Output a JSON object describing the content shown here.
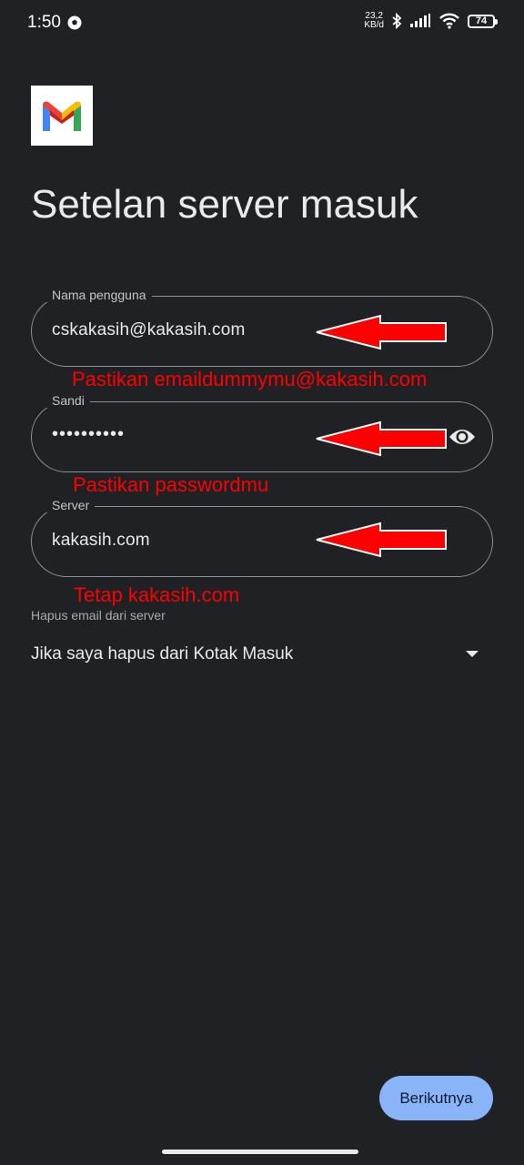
{
  "status_bar": {
    "time": "1:50",
    "net_speed_value": "23,2",
    "net_speed_unit": "KB/d",
    "battery": "74",
    "icons": [
      "soccer-ball-icon",
      "bluetooth-icon",
      "signal-icon",
      "wifi-icon",
      "battery-icon"
    ]
  },
  "page": {
    "title": "Setelan server masuk"
  },
  "fields": {
    "username": {
      "label": "Nama pengguna",
      "value": "cskakasih@kakasih.com"
    },
    "password": {
      "label": "Sandi",
      "value": "••••••••••"
    },
    "server": {
      "label": "Server",
      "value": "kakasih.com"
    }
  },
  "annotations": {
    "username_note": "Pastikan emaildummymu@kakasih.com",
    "password_note": "Pastikan passwordmu",
    "server_note": "Tetap kakasih.com"
  },
  "delete_setting": {
    "label": "Hapus email dari server",
    "selected": "Jika saya hapus dari Kotak Masuk"
  },
  "actions": {
    "next_label": "Berikutnya"
  },
  "colors": {
    "background": "#202124",
    "primary_button": "#8ab4f8",
    "annotation_red": "#ff0000",
    "field_border": "#8e9196"
  }
}
